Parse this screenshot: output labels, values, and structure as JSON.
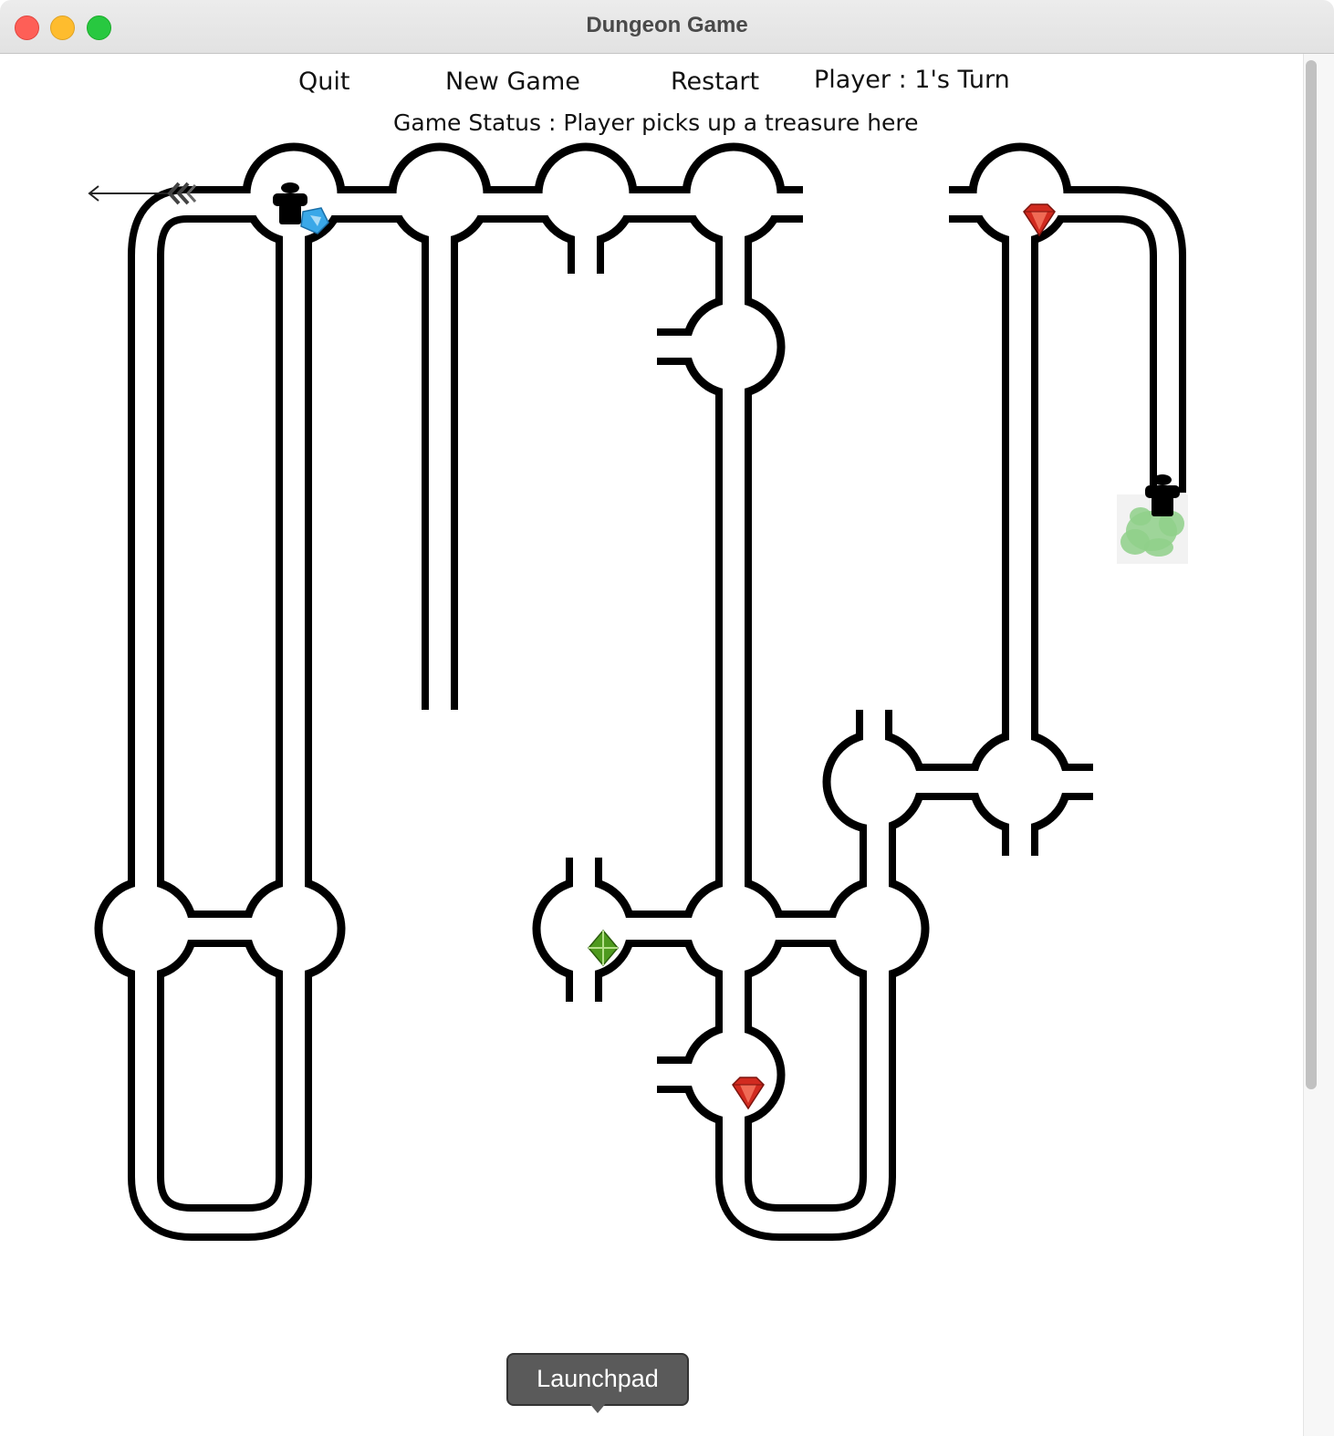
{
  "window": {
    "title": "Dungeon Game"
  },
  "menu": {
    "quit": "Quit",
    "new_game": "New Game",
    "restart": "Restart",
    "turn": "Player : 1's Turn"
  },
  "status": {
    "text": "Game Status : Player picks up a treasure here"
  },
  "tooltip": {
    "label": "Launchpad"
  },
  "icons": {
    "player": "player-icon",
    "sapphire": "sapphire-icon",
    "ruby": "ruby-icon",
    "emerald": "emerald-icon",
    "arrow": "arrow-icon",
    "smell": "monster-smell-icon"
  },
  "colors": {
    "wall": "#000000",
    "ruby": "#d12a1f",
    "sapphire": "#3aa8e8",
    "emerald": "#4e9a1e",
    "smell": "#8fd08a"
  }
}
